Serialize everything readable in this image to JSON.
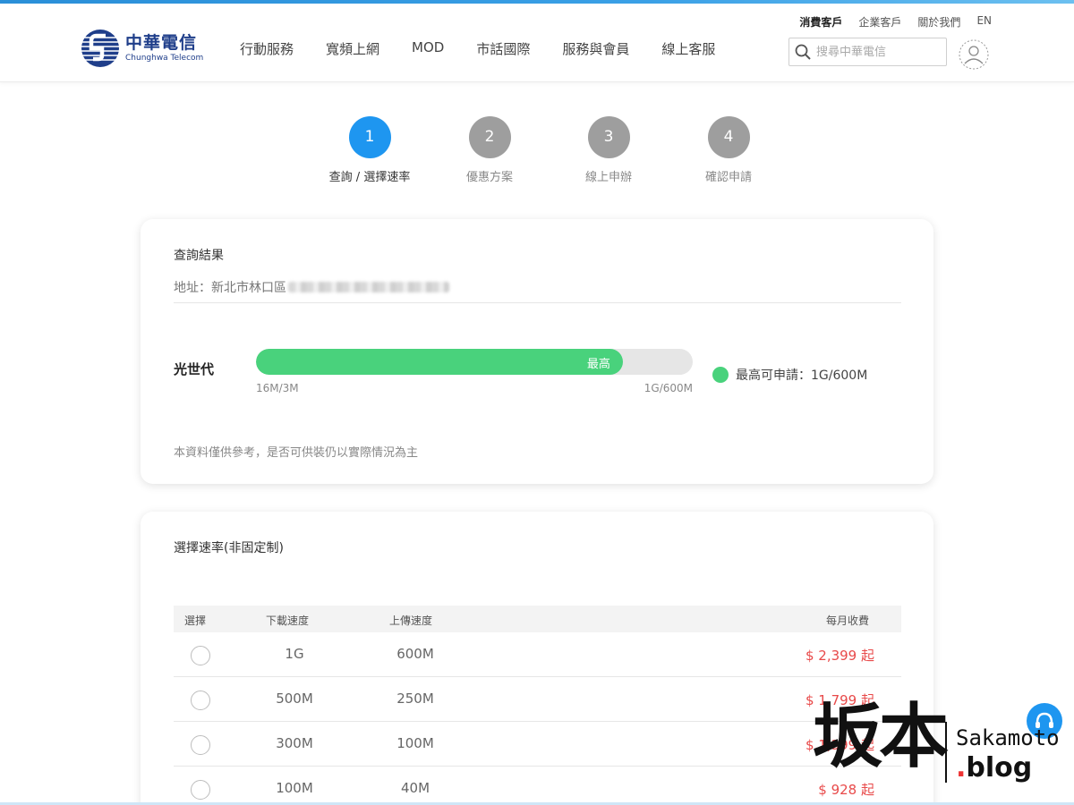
{
  "header": {
    "logo_cn": "中華電信",
    "logo_en": "Chunghwa Telecom",
    "nav": [
      "行動服務",
      "寬頻上網",
      "MOD",
      "市話國際",
      "服務與會員",
      "線上客服"
    ],
    "util": [
      "消費客戶",
      "企業客戶",
      "關於我們",
      "EN"
    ],
    "search_placeholder": "搜尋中華電信"
  },
  "steps": [
    {
      "num": "1",
      "label": "查詢 / 選擇速率",
      "active": true
    },
    {
      "num": "2",
      "label": "優惠方案",
      "active": false
    },
    {
      "num": "3",
      "label": "線上申辦",
      "active": false
    },
    {
      "num": "4",
      "label": "確認申請",
      "active": false
    }
  ],
  "result": {
    "title": "查詢結果",
    "address_prefix": "地址：新北市林口區",
    "plan": "光世代",
    "bar_label": "最高",
    "bar_fill_fraction": 0.84,
    "bar_min": "16M/3M",
    "bar_max": "1G/600M",
    "legend": "最高可申請：1G/600M",
    "note": "本資料僅供參考，是否可供裝仍以實際情況為主"
  },
  "speeds": {
    "title": "選擇速率(非固定制)",
    "headers": {
      "select": "選擇",
      "download": "下載速度",
      "upload": "上傳速度",
      "fee": "每月收費"
    },
    "rows": [
      {
        "download": "1G",
        "upload": "600M",
        "price": "$ 2,399 起"
      },
      {
        "download": "500M",
        "upload": "250M",
        "price": "$ 1,799 起"
      },
      {
        "download": "300M",
        "upload": "100M",
        "price": "$ 1,399 起"
      },
      {
        "download": "100M",
        "upload": "40M",
        "price": "$ 928 起"
      }
    ]
  },
  "watermark": {
    "cn": "坂本",
    "en1": "Sakamoto",
    "en2": "blog",
    "dot": "."
  },
  "colors": {
    "accent": "#1e96f0",
    "bar": "#49d27c",
    "price": "#e84a4a"
  }
}
